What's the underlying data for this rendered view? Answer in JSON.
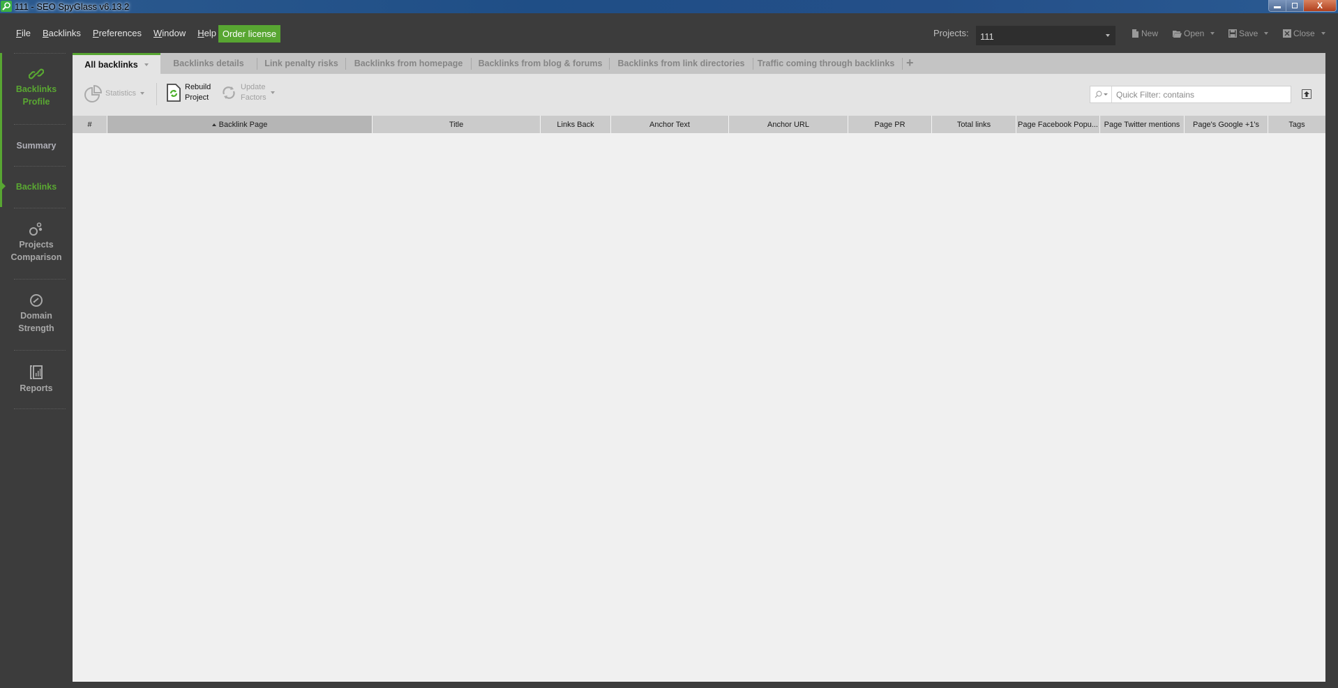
{
  "window": {
    "title": "111 - SEO SpyGlass v6.13.2",
    "controls": {
      "minimize": "—",
      "restore": "❐",
      "close": "X"
    }
  },
  "menu": {
    "items": [
      {
        "label": "File",
        "mnemonic": "F",
        "rest": "ile"
      },
      {
        "label": "Backlinks",
        "mnemonic": "B",
        "rest": "acklinks"
      },
      {
        "label": "Preferences",
        "mnemonic": "P",
        "rest": "references"
      },
      {
        "label": "Window",
        "mnemonic": "W",
        "rest": "indow"
      },
      {
        "label": "Help",
        "mnemonic": "H",
        "rest": "elp"
      }
    ],
    "order_license": "Order license"
  },
  "projects": {
    "label": "Projects:",
    "selected": "111"
  },
  "file_actions": {
    "new": "New",
    "open": "Open",
    "save": "Save",
    "close": "Close"
  },
  "sidebar": {
    "items": [
      {
        "label_line1": "Backlinks",
        "label_line2": "Profile",
        "icon": "link-icon",
        "active": true
      },
      {
        "label_line1": "Summary",
        "active": false
      },
      {
        "label_line1": "Backlinks",
        "active": true
      },
      {
        "label_line1": "Projects",
        "label_line2": "Comparison",
        "icon": "bubbles-icon",
        "active": false
      },
      {
        "label_line1": "Domain",
        "label_line2": "Strength",
        "icon": "gauge-icon",
        "active": false
      },
      {
        "label_line1": "Reports",
        "icon": "report-icon",
        "active": false
      }
    ]
  },
  "tabs": [
    {
      "label": "All backlinks",
      "active": true
    },
    {
      "label": "Backlinks details"
    },
    {
      "label": "Link penalty risks"
    },
    {
      "label": "Backlinks from homepage"
    },
    {
      "label": "Backlinks from blog & forums"
    },
    {
      "label": "Backlinks from link directories"
    },
    {
      "label": "Traffic coming through backlinks"
    }
  ],
  "tab_add": "+",
  "toolbar": {
    "statistics": "Statistics",
    "rebuild_line1": "Rebuild",
    "rebuild_line2": "Project",
    "update_line1": "Update",
    "update_line2": "Factors",
    "filter_placeholder": "Quick Filter: contains",
    "filter_value": ""
  },
  "table": {
    "columns": [
      {
        "label": "#"
      },
      {
        "label": "Backlink Page",
        "sorted": "ascending"
      },
      {
        "label": "Title"
      },
      {
        "label": "Links Back"
      },
      {
        "label": "Anchor Text"
      },
      {
        "label": "Anchor URL"
      },
      {
        "label": "Page PR"
      },
      {
        "label": "Total links"
      },
      {
        "label": "Page Facebook Popu..."
      },
      {
        "label": "Page Twitter mentions"
      },
      {
        "label": "Page's Google +1's"
      },
      {
        "label": "Tags"
      }
    ],
    "rows": []
  },
  "colors": {
    "accent_green": "#58a632",
    "chrome_dark": "#3c3c3c",
    "content_bg": "#f0f0f0"
  }
}
